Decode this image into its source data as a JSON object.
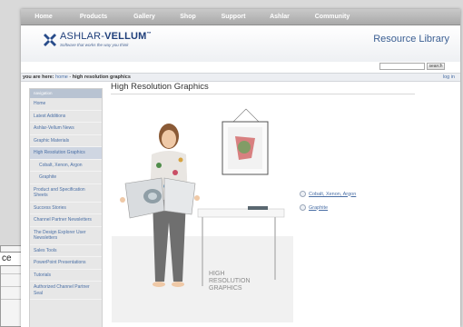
{
  "back_window": {
    "field_text": "ce"
  },
  "topnav": {
    "items": [
      "Home",
      "Products",
      "Gallery",
      "Shop",
      "Support",
      "Ashlar",
      "Community"
    ]
  },
  "header": {
    "logo_name_bold": "ASHLAR-",
    "logo_name_light": "VELLUM",
    "logo_tm": "™",
    "tagline": "Software that works the way you think",
    "section_title": "Resource Library"
  },
  "search": {
    "button_label": "search",
    "value": ""
  },
  "breadcrumb": {
    "label": "you are here:",
    "home": "home",
    "separator": " - ",
    "current": "high resolution graphics",
    "login": "log in"
  },
  "sidebar": {
    "heading": "navigation",
    "items": [
      {
        "label": "Home",
        "sub": false,
        "active": false
      },
      {
        "label": "Latest Additions",
        "sub": false,
        "active": false
      },
      {
        "label": "Ashlar-Vellum News",
        "sub": false,
        "active": false
      },
      {
        "label": "Graphic Materials",
        "sub": false,
        "active": false
      },
      {
        "label": "High Resolution Graphics",
        "sub": false,
        "active": true
      },
      {
        "label": "Cobalt, Xenon, Argon",
        "sub": true,
        "active": false
      },
      {
        "label": "Graphite",
        "sub": true,
        "active": false
      },
      {
        "label": "Product and Specification Sheets",
        "sub": false,
        "active": false
      },
      {
        "label": "Success Stories",
        "sub": false,
        "active": false
      },
      {
        "label": "Channel Partner Newsletters",
        "sub": false,
        "active": false
      },
      {
        "label": "The Design Explorer User Newsletters",
        "sub": false,
        "active": false
      },
      {
        "label": "Sales Tools",
        "sub": false,
        "active": false
      },
      {
        "label": "PowerPoint Presentations",
        "sub": false,
        "active": false
      },
      {
        "label": "Tutorials",
        "sub": false,
        "active": false
      },
      {
        "label": "Authorized Channel Partner Seal",
        "sub": false,
        "active": false
      }
    ]
  },
  "main": {
    "title": "High Resolution Graphics",
    "scene_caption": [
      "HIGH",
      "RESOLUTION",
      "GRAPHICS"
    ],
    "links": [
      "Cobalt, Xenon, Argon",
      "Graphite"
    ]
  },
  "colors": {
    "link": "#4a6fa5",
    "brand": "#1f3f7a",
    "nav_bar": "#b0b0b0"
  }
}
